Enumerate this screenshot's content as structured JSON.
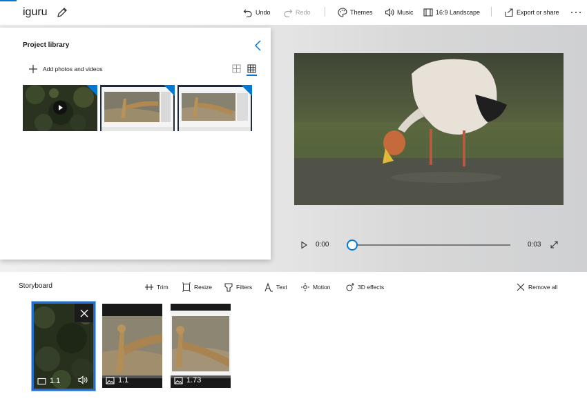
{
  "app": {
    "title": "iguru"
  },
  "toolbar": {
    "undo_label": "Undo",
    "redo_label": "Redo",
    "themes_label": "Themes",
    "music_label": "Music",
    "aspect_label": "16:9 Landscape",
    "export_label": "Export or share"
  },
  "library": {
    "title": "Project library",
    "add_label": "Add photos and videos",
    "items": [
      {
        "kind": "video",
        "icon": "play-icon"
      },
      {
        "kind": "image"
      },
      {
        "kind": "image"
      }
    ]
  },
  "player": {
    "current_time": "0:00",
    "total_time": "0:03",
    "progress": 0.0
  },
  "storyboard": {
    "title": "Storyboard",
    "tools": {
      "trim": "Trim",
      "resize": "Resize",
      "filters": "Filters",
      "text": "Text",
      "motion": "Motion",
      "effects_3d": "3D effects",
      "remove_all": "Remove all"
    },
    "cards": [
      {
        "duration": "1.1",
        "selected": true,
        "icon": "video-icon"
      },
      {
        "duration": "1.1",
        "selected": false,
        "icon": "image-icon"
      },
      {
        "duration": "1.73",
        "selected": false,
        "icon": "image-icon"
      }
    ]
  },
  "colors": {
    "accent": "#0078d4",
    "selection_border": "#1f6fcf"
  }
}
